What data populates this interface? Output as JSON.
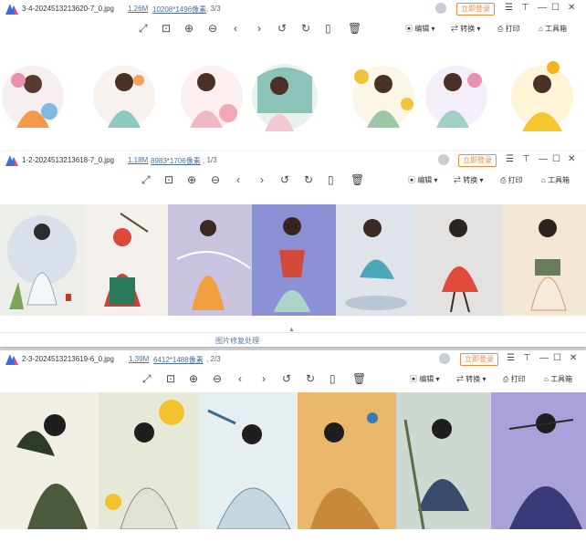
{
  "windows": [
    {
      "filename": "3-4-2024513213620-7_0.jpg",
      "size": "1.26M",
      "dims": "10208*1496像素",
      "page": ", 3/3",
      "login": "立即登录",
      "tools": {
        "edit": "编辑",
        "convert": "转换",
        "print": "打印",
        "toolbox": "工具箱"
      }
    },
    {
      "filename": "1-2-2024513213618-7_0.jpg",
      "size": "1.18M",
      "dims": "8983*1706像素",
      "page": ", 1/3",
      "login": "立即登录",
      "tools": {
        "edit": "编辑",
        "convert": "转换",
        "print": "打印",
        "toolbox": "工具箱"
      }
    },
    {
      "filename": "2-3-2024513213619-6_0.jpg",
      "size": "1.39M",
      "dims": "6412*1488像素",
      "page": ", 2/3",
      "login": "立即登录",
      "tools": {
        "edit": "编辑",
        "convert": "转换",
        "print": "打印",
        "toolbox": "工具箱"
      }
    }
  ],
  "background_snippet": "图片修复处理",
  "colors": {
    "accent": "#f08a3c",
    "link": "#4a6fa5"
  }
}
